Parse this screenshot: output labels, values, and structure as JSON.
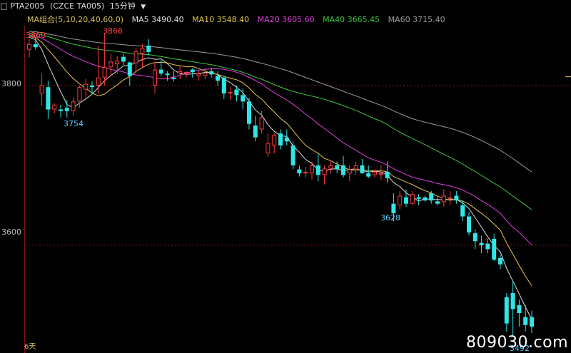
{
  "header": {
    "icon": "square-icon",
    "symbol": "PTA2005",
    "exchange": "(CZCE TA005)",
    "period": "15分钟",
    "dropdown": "▼"
  },
  "legend": {
    "group": "MA组合(5,10,20,40,60,0)",
    "ma5": "MA5 3490.40",
    "ma10": "MA10 3548.40",
    "ma20": "MA20 3605.60",
    "ma40": "MA40 3665.45",
    "ma60": "MA60 3715.40",
    "colors": {
      "group": "#d6c25a",
      "ma5": "#dddddd",
      "ma10": "#e6c84a",
      "ma20": "#e040e0",
      "ma40": "#3ec83e",
      "ma60": "#9a9a9a"
    }
  },
  "yaxis": {
    "label_3800": "3800",
    "label_3600": "3600"
  },
  "annotations": {
    "high1": "3860",
    "high2": "3866",
    "low1": "3754",
    "low2": "3628",
    "low3": "3492",
    "colors": {
      "high": "#ff4040",
      "low": "#5ec8ff"
    }
  },
  "footer": {
    "days": "6天",
    "watermark": "809030.com"
  },
  "chart_data": {
    "type": "candlestick",
    "ylim": [
      3465,
      3875
    ],
    "grid_levels": [
      3800,
      3600
    ],
    "ohlc": [
      [
        3845,
        3858,
        3835,
        3852
      ],
      [
        3852,
        3860,
        3845,
        3848
      ],
      [
        3790,
        3815,
        3775,
        3800
      ],
      [
        3798,
        3806,
        3758,
        3770
      ],
      [
        3770,
        3778,
        3765,
        3776
      ],
      [
        3770,
        3776,
        3760,
        3768
      ],
      [
        3772,
        3782,
        3760,
        3768
      ],
      [
        3768,
        3785,
        3762,
        3780
      ],
      [
        3780,
        3800,
        3772,
        3798
      ],
      [
        3795,
        3808,
        3785,
        3802
      ],
      [
        3800,
        3805,
        3790,
        3798
      ],
      [
        3800,
        3850,
        3790,
        3810
      ],
      [
        3810,
        3866,
        3800,
        3823
      ],
      [
        3823,
        3840,
        3812,
        3830
      ],
      [
        3827,
        3837,
        3815,
        3831
      ],
      [
        3836,
        3840,
        3826,
        3830
      ],
      [
        3829,
        3830,
        3800,
        3812
      ],
      [
        3828,
        3847,
        3818,
        3843
      ],
      [
        3840,
        3852,
        3822,
        3847
      ],
      [
        3850,
        3858,
        3838,
        3842
      ],
      [
        3800,
        3830,
        3790,
        3820
      ],
      [
        3820,
        3832,
        3812,
        3815
      ],
      [
        3815,
        3818,
        3806,
        3813
      ],
      [
        3810,
        3818,
        3805,
        3808
      ],
      [
        3815,
        3825,
        3808,
        3818
      ],
      [
        3816,
        3818,
        3810,
        3817
      ],
      [
        3820,
        3822,
        3810,
        3817
      ],
      [
        3812,
        3818,
        3806,
        3815
      ],
      [
        3812,
        3822,
        3808,
        3816
      ],
      [
        3818,
        3822,
        3810,
        3814
      ],
      [
        3812,
        3818,
        3800,
        3806
      ],
      [
        3810,
        3812,
        3783,
        3790
      ],
      [
        3790,
        3798,
        3782,
        3792
      ],
      [
        3795,
        3800,
        3780,
        3788
      ],
      [
        3788,
        3796,
        3770,
        3780
      ],
      [
        3780,
        3785,
        3745,
        3752
      ],
      [
        3750,
        3762,
        3730,
        3735
      ],
      [
        3745,
        3768,
        3740,
        3760
      ],
      [
        3715,
        3740,
        3710,
        3728
      ],
      [
        3725,
        3740,
        3715,
        3738
      ],
      [
        3740,
        3745,
        3720,
        3725
      ],
      [
        3735,
        3745,
        3725,
        3730
      ],
      [
        3725,
        3730,
        3695,
        3700
      ],
      [
        3695,
        3700,
        3686,
        3690
      ],
      [
        3690,
        3698,
        3685,
        3692
      ],
      [
        3690,
        3705,
        3682,
        3700
      ],
      [
        3700,
        3715,
        3680,
        3688
      ],
      [
        3688,
        3700,
        3676,
        3696
      ],
      [
        3696,
        3705,
        3690,
        3700
      ],
      [
        3700,
        3705,
        3690,
        3695
      ],
      [
        3700,
        3712,
        3685,
        3688
      ],
      [
        3690,
        3700,
        3680,
        3695
      ],
      [
        3695,
        3705,
        3688,
        3700
      ],
      [
        3700,
        3708,
        3690,
        3690
      ],
      [
        3690,
        3700,
        3684,
        3686
      ],
      [
        3688,
        3695,
        3685,
        3692
      ],
      [
        3688,
        3700,
        3682,
        3690
      ],
      [
        3692,
        3705,
        3678,
        3684
      ],
      [
        3652,
        3665,
        3630,
        3640
      ],
      [
        3650,
        3668,
        3645,
        3662
      ],
      [
        3660,
        3670,
        3648,
        3652
      ],
      [
        3652,
        3668,
        3650,
        3664
      ],
      [
        3660,
        3664,
        3650,
        3658
      ],
      [
        3660,
        3662,
        3655,
        3656
      ],
      [
        3665,
        3668,
        3652,
        3656
      ],
      [
        3655,
        3662,
        3650,
        3652
      ],
      [
        3654,
        3670,
        3648,
        3662
      ],
      [
        3658,
        3668,
        3650,
        3660
      ],
      [
        3662,
        3668,
        3652,
        3656
      ],
      [
        3650,
        3656,
        3630,
        3636
      ],
      [
        3636,
        3642,
        3612,
        3616
      ],
      [
        3615,
        3620,
        3595,
        3605
      ],
      [
        3603,
        3612,
        3590,
        3600
      ],
      [
        3602,
        3608,
        3590,
        3595
      ],
      [
        3608,
        3614,
        3580,
        3582
      ],
      [
        3584,
        3588,
        3570,
        3576
      ],
      [
        3535,
        3540,
        3492,
        3502
      ],
      [
        3540,
        3555,
        3485,
        3520
      ],
      [
        3525,
        3532,
        3498,
        3515
      ],
      [
        3510,
        3525,
        3492,
        3500
      ],
      [
        3510,
        3518,
        3490,
        3498
      ]
    ]
  }
}
